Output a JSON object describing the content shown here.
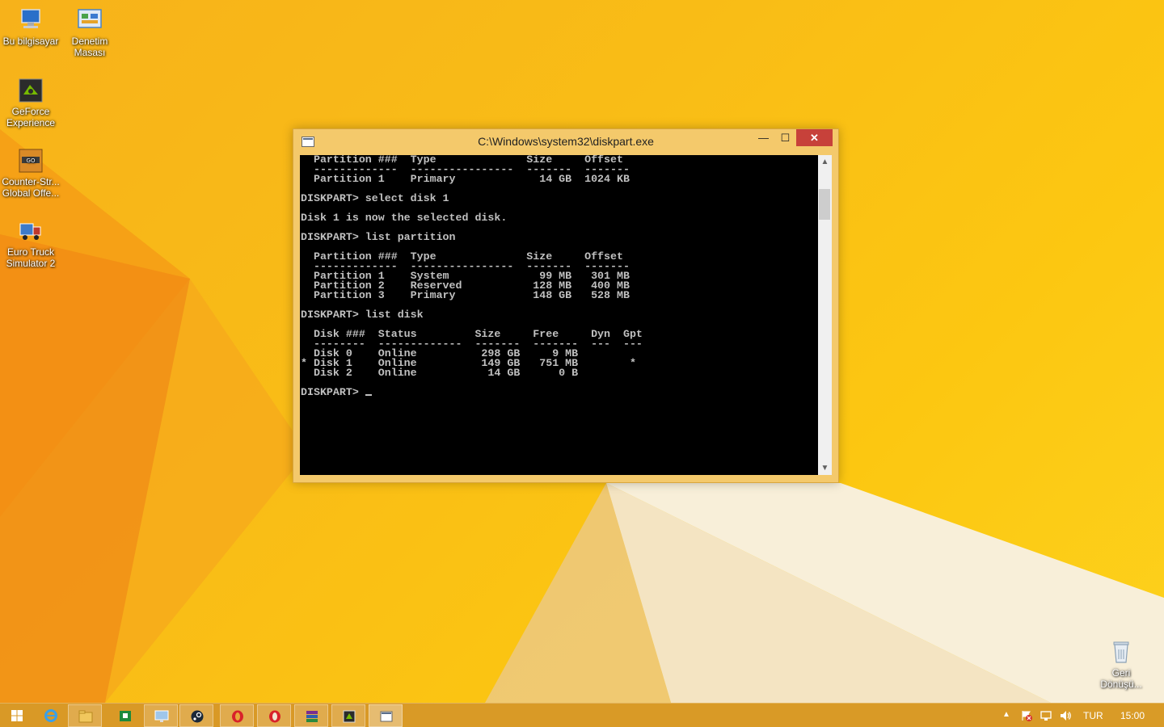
{
  "desktop": {
    "icons": [
      {
        "label_1": "Bu bilgisayar",
        "label_2": ""
      },
      {
        "label_1": "Denetim",
        "label_2": "Masası"
      },
      {
        "label_1": "GeForce",
        "label_2": "Experience"
      },
      {
        "label_1": "Counter-Str...",
        "label_2": "Global Offe..."
      },
      {
        "label_1": "Euro Truck",
        "label_2": "Simulator 2"
      },
      {
        "label_1": "Geri",
        "label_2": "Dönüşü..."
      }
    ]
  },
  "window": {
    "title": "C:\\Windows\\system32\\diskpart.exe",
    "minimize_glyph": "—",
    "maximize_glyph": "☐",
    "close_glyph": "✕",
    "console_lines": [
      "  Partition ###  Type              Size     Offset",
      "  -------------  ----------------  -------  -------",
      "  Partition 1    Primary             14 GB  1024 KB",
      "",
      "DISKPART> select disk 1",
      "",
      "Disk 1 is now the selected disk.",
      "",
      "DISKPART> list partition",
      "",
      "  Partition ###  Type              Size     Offset",
      "  -------------  ----------------  -------  -------",
      "  Partition 1    System              99 MB   301 MB",
      "  Partition 2    Reserved           128 MB   400 MB",
      "  Partition 3    Primary            148 GB   528 MB",
      "",
      "DISKPART> list disk",
      "",
      "  Disk ###  Status         Size     Free     Dyn  Gpt",
      "  --------  -------------  -------  -------  ---  ---",
      "  Disk 0    Online          298 GB     9 MB",
      "* Disk 1    Online          149 GB   751 MB        *",
      "  Disk 2    Online           14 GB      0 B",
      ""
    ],
    "prompt": "DISKPART> "
  },
  "taskbar": {
    "language": "TUR",
    "clock": "15:00"
  },
  "colors": {
    "accent": "#f9bd16",
    "close_red": "#c7413a",
    "console_bg": "#000000",
    "console_fg": "#c0c0c0"
  }
}
